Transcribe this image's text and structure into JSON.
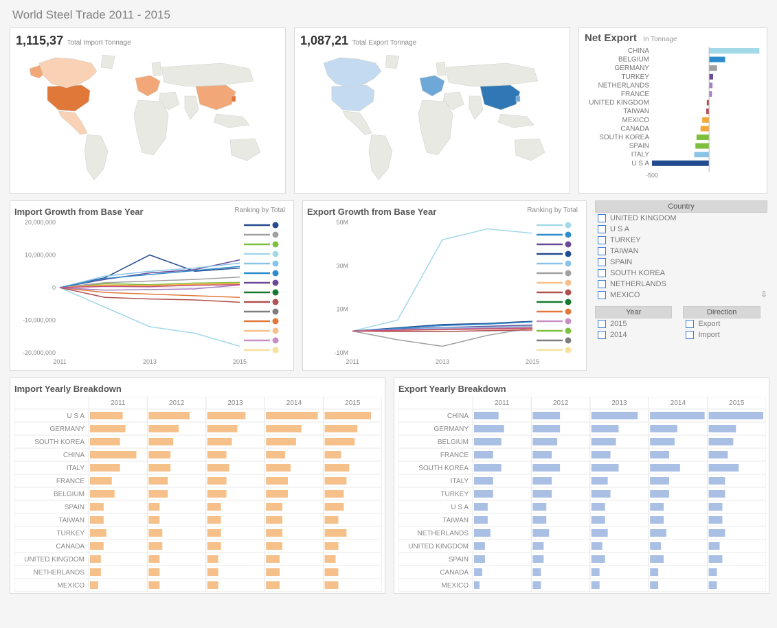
{
  "title": "World Steel Trade 2011 - 2015",
  "kpi": {
    "import": {
      "value": "1,115,37",
      "label": "Total Import Tonnage"
    },
    "export": {
      "value": "1,087,21",
      "label": "Total Export Tonnage"
    }
  },
  "net_export": {
    "title": "Net Export",
    "sub": "In Tonnage",
    "tick": "-500"
  },
  "growth": {
    "import_title": "Import Growth from Base Year",
    "export_title": "Export Growth from Base Year",
    "ranking": "Ranking by Total"
  },
  "filters": {
    "country_head": "Country",
    "countries": [
      "UNITED KINGDOM",
      "U S A",
      "TURKEY",
      "TAIWAN",
      "SPAIN",
      "SOUTH KOREA",
      "NETHERLANDS",
      "MEXICO"
    ],
    "year_head": "Year",
    "years": [
      "2015",
      "2014"
    ],
    "dir_head": "Direction",
    "directions": [
      "Export",
      "Import"
    ]
  },
  "yearly": {
    "import_title": "Import Yearly Breakdown",
    "export_title": "Export Yearly Breakdown"
  },
  "colors": {
    "import_bar": "#f5c089",
    "export_bar": "#a9bfe4",
    "orange_dark": "#e0783a",
    "orange_mid": "#f1a778",
    "orange_light": "#f9d2b5",
    "blue_dark": "#2f77b5",
    "blue_mid": "#6ea8d8",
    "blue_light": "#c3daf1",
    "land": "#e9e9e4",
    "land_stroke": "#d3d3cc",
    "net": {
      "usa": "#234b8f",
      "china": "#a2d8e8",
      "belgium": "#2d8ccb",
      "germany": "#a0a0a0",
      "turkey": "#6a4a98",
      "netherlands": "#a57fc1",
      "france": "#a57fc1",
      "southkorea": "#7fbf3f",
      "uk": "#b05050",
      "taiwan": "#b05050",
      "mexico": "#f2a93b",
      "canada": "#f2a93b",
      "spain": "#7fbf3f",
      "italy": "#89c4e8"
    }
  },
  "chart_data": {
    "net_export": {
      "type": "bar",
      "orientation": "h",
      "xlabel": "",
      "ylabel": "",
      "xlim": [
        -500,
        450
      ],
      "categories": [
        "CHINA",
        "BELGIUM",
        "GERMANY",
        "TURKEY",
        "NETHERLANDS",
        "FRANCE",
        "UNITED KINGDOM",
        "TAIWAN",
        "MEXICO",
        "CANADA",
        "SOUTH KOREA",
        "SPAIN",
        "ITALY",
        "U S A"
      ],
      "values": [
        440,
        140,
        70,
        35,
        30,
        25,
        -20,
        -25,
        -60,
        -75,
        -110,
        -120,
        -130,
        -500
      ],
      "color_keys": [
        "china",
        "belgium",
        "germany",
        "turkey",
        "netherlands",
        "france",
        "uk",
        "taiwan",
        "mexico",
        "canada",
        "southkorea",
        "spain",
        "italy",
        "usa"
      ]
    },
    "import_growth": {
      "type": "line",
      "x": [
        2011,
        2012,
        2013,
        2014,
        2015
      ],
      "ylim": [
        -20000000,
        20000000
      ],
      "yticks": [
        "20,000,000",
        "10,000,000",
        "0",
        "-10,000,000",
        "-20,000,000"
      ],
      "xticks": [
        "2011",
        "2013",
        "2015"
      ],
      "series": [
        {
          "color": "#234b8f",
          "values": [
            0,
            3000000,
            10000000,
            5000000,
            6000000
          ]
        },
        {
          "color": "#e0783a",
          "values": [
            0,
            -1500000,
            -2000000,
            -2500000,
            -3000000
          ]
        },
        {
          "color": "#7fbf3f",
          "values": [
            0,
            1200000,
            900000,
            1400000,
            1600000
          ]
        },
        {
          "color": "#a2d8e8",
          "values": [
            0,
            -6000000,
            -12000000,
            -14000000,
            -18000000
          ]
        },
        {
          "color": "#f5c089",
          "values": [
            0,
            500000,
            700000,
            900000,
            1100000
          ]
        },
        {
          "color": "#b05050",
          "values": [
            0,
            -3000000,
            -3500000,
            -3800000,
            -4500000
          ]
        },
        {
          "color": "#6a4a98",
          "values": [
            0,
            2500000,
            4500000,
            5500000,
            8500000
          ]
        },
        {
          "color": "#a0a0a0",
          "values": [
            0,
            1500000,
            2000000,
            2500000,
            3200000
          ]
        },
        {
          "color": "#f2a93b",
          "values": [
            0,
            800000,
            600000,
            1000000,
            1300000
          ]
        },
        {
          "color": "#89c4e8",
          "values": [
            0,
            3500000,
            5000000,
            6000000,
            7500000
          ]
        },
        {
          "color": "#2d8ccb",
          "values": [
            0,
            2800000,
            4000000,
            5200000,
            6500000
          ]
        },
        {
          "color": "#a57fc1",
          "values": [
            0,
            -800000,
            -600000,
            -400000,
            800000
          ]
        },
        {
          "color": "#c94f7c",
          "values": [
            0,
            400000,
            300000,
            700000,
            900000
          ]
        }
      ]
    },
    "export_growth": {
      "type": "line",
      "x": [
        2011,
        2012,
        2013,
        2014,
        2015
      ],
      "ylim": [
        -10000000,
        50000000
      ],
      "yticks": [
        "50M",
        "30M",
        "10M",
        "-10M"
      ],
      "xticks": [
        "2011",
        "2013",
        "2015"
      ],
      "series": [
        {
          "color": "#a2d8e8",
          "values": [
            0,
            5000000,
            42000000,
            47000000,
            45000000
          ]
        },
        {
          "color": "#234b8f",
          "values": [
            0,
            1500000,
            3000000,
            3500000,
            4500000
          ]
        },
        {
          "color": "#7fbf3f",
          "values": [
            0,
            1000000,
            1500000,
            2000000,
            2500000
          ]
        },
        {
          "color": "#a0a0a0",
          "values": [
            0,
            -4000000,
            -7000000,
            -2000000,
            1500000
          ]
        },
        {
          "color": "#e0783a",
          "values": [
            0,
            500000,
            800000,
            1200000,
            1100000
          ]
        },
        {
          "color": "#f5c089",
          "values": [
            0,
            800000,
            1200000,
            1500000,
            2000000
          ]
        },
        {
          "color": "#6a4a98",
          "values": [
            0,
            900000,
            1600000,
            2200000,
            2800000
          ]
        },
        {
          "color": "#b05050",
          "values": [
            0,
            -300000,
            -200000,
            200000,
            500000
          ]
        },
        {
          "color": "#2d8ccb",
          "values": [
            0,
            1200000,
            2500000,
            3200000,
            4200000
          ]
        },
        {
          "color": "#89c4e8",
          "values": [
            0,
            700000,
            1400000,
            1800000,
            2300000
          ]
        },
        {
          "color": "#a57fc1",
          "values": [
            0,
            600000,
            900000,
            1300000,
            1600000
          ]
        },
        {
          "color": "#f2a93b",
          "values": [
            0,
            300000,
            600000,
            900000,
            1200000
          ]
        },
        {
          "color": "#c94f7c",
          "values": [
            0,
            400000,
            700000,
            1000000,
            1300000
          ]
        }
      ]
    },
    "import_yearly": {
      "type": "bar",
      "years": [
        "2011",
        "2012",
        "2013",
        "2014",
        "2015"
      ],
      "rows": [
        {
          "name": "U S A",
          "values": [
            60,
            75,
            70,
            95,
            85
          ]
        },
        {
          "name": "GERMANY",
          "values": [
            65,
            55,
            55,
            65,
            60
          ]
        },
        {
          "name": "SOUTH KOREA",
          "values": [
            55,
            45,
            45,
            55,
            55
          ]
        },
        {
          "name": "CHINA",
          "values": [
            85,
            40,
            35,
            35,
            30
          ]
        },
        {
          "name": "ITALY",
          "values": [
            55,
            40,
            40,
            45,
            45
          ]
        },
        {
          "name": "FRANCE",
          "values": [
            40,
            35,
            35,
            40,
            40
          ]
        },
        {
          "name": "BELGIUM",
          "values": [
            45,
            35,
            35,
            40,
            35
          ]
        },
        {
          "name": "SPAIN",
          "values": [
            25,
            20,
            25,
            30,
            35
          ]
        },
        {
          "name": "TAIWAN",
          "values": [
            25,
            20,
            25,
            30,
            25
          ]
        },
        {
          "name": "TURKEY",
          "values": [
            30,
            25,
            25,
            30,
            40
          ]
        },
        {
          "name": "CANADA",
          "values": [
            25,
            25,
            25,
            30,
            25
          ]
        },
        {
          "name": "UNITED KINGDOM",
          "values": [
            20,
            20,
            20,
            25,
            20
          ]
        },
        {
          "name": "NETHERLANDS",
          "values": [
            20,
            20,
            20,
            25,
            25
          ]
        },
        {
          "name": "MEXICO",
          "values": [
            15,
            20,
            20,
            25,
            25
          ]
        }
      ]
    },
    "export_yearly": {
      "type": "bar",
      "years": [
        "2011",
        "2012",
        "2013",
        "2014",
        "2015"
      ],
      "rows": [
        {
          "name": "CHINA",
          "values": [
            45,
            50,
            85,
            100,
            100
          ]
        },
        {
          "name": "GERMANY",
          "values": [
            55,
            50,
            50,
            50,
            50
          ]
        },
        {
          "name": "BELGIUM",
          "values": [
            50,
            45,
            45,
            45,
            45
          ]
        },
        {
          "name": "FRANCE",
          "values": [
            35,
            35,
            35,
            35,
            35
          ]
        },
        {
          "name": "SOUTH KOREA",
          "values": [
            50,
            50,
            50,
            55,
            55
          ]
        },
        {
          "name": "ITALY",
          "values": [
            35,
            35,
            30,
            35,
            30
          ]
        },
        {
          "name": "TURKEY",
          "values": [
            35,
            35,
            35,
            35,
            30
          ]
        },
        {
          "name": "U S A",
          "values": [
            25,
            25,
            25,
            25,
            25
          ]
        },
        {
          "name": "TAIWAN",
          "values": [
            25,
            25,
            25,
            25,
            25
          ]
        },
        {
          "name": "NETHERLANDS",
          "values": [
            30,
            30,
            30,
            30,
            30
          ]
        },
        {
          "name": "UNITED KINGDOM",
          "values": [
            20,
            20,
            20,
            20,
            20
          ]
        },
        {
          "name": "SPAIN",
          "values": [
            20,
            20,
            25,
            25,
            25
          ]
        },
        {
          "name": "CANADA",
          "values": [
            15,
            15,
            15,
            15,
            15
          ]
        },
        {
          "name": "MEXICO",
          "values": [
            10,
            15,
            15,
            15,
            15
          ]
        }
      ]
    },
    "ranking_dots": {
      "import": [
        "#234b8f",
        "#a0a0a0",
        "#7fbf3f",
        "#a2d8e8",
        "#89c4e8",
        "#2d8ccb",
        "#6a4a98",
        "#127a2f",
        "#b05050",
        "#7d7d7d",
        "#e0783a",
        "#f5c089",
        "#c98fc4",
        "#f7e09a"
      ],
      "export": [
        "#a2d8e8",
        "#2d8ccb",
        "#6a4a98",
        "#234b8f",
        "#89c4e8",
        "#a0a0a0",
        "#f5c089",
        "#b05050",
        "#127a2f",
        "#e0783a",
        "#c98fc4",
        "#7fbf3f",
        "#7d7d7d",
        "#f7e09a"
      ]
    }
  }
}
